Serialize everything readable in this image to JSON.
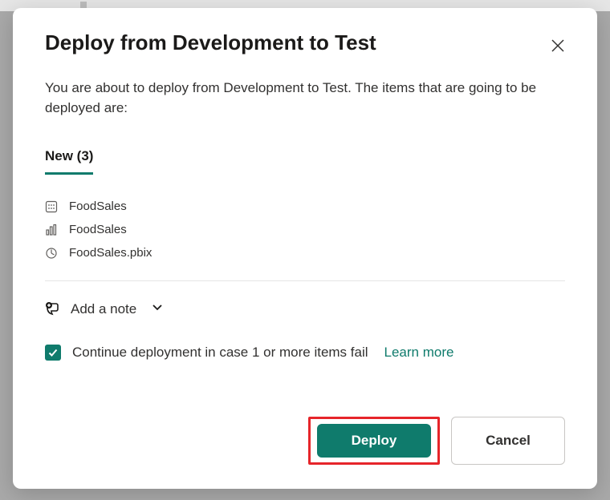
{
  "modal": {
    "title": "Deploy from Development to Test",
    "description": "You are about to deploy from Development to Test. The items that are going to be deployed are:",
    "tab_label": "New (3)",
    "items": [
      {
        "name": "FoodSales",
        "icon": "dataset-icon"
      },
      {
        "name": "FoodSales",
        "icon": "report-icon"
      },
      {
        "name": "FoodSales.pbix",
        "icon": "dashboard-icon"
      }
    ],
    "add_note_label": "Add a note",
    "continue_label": "Continue deployment in case 1 or more items fail",
    "learn_more_label": "Learn more",
    "deploy_label": "Deploy",
    "cancel_label": "Cancel",
    "checkbox_checked": true
  }
}
